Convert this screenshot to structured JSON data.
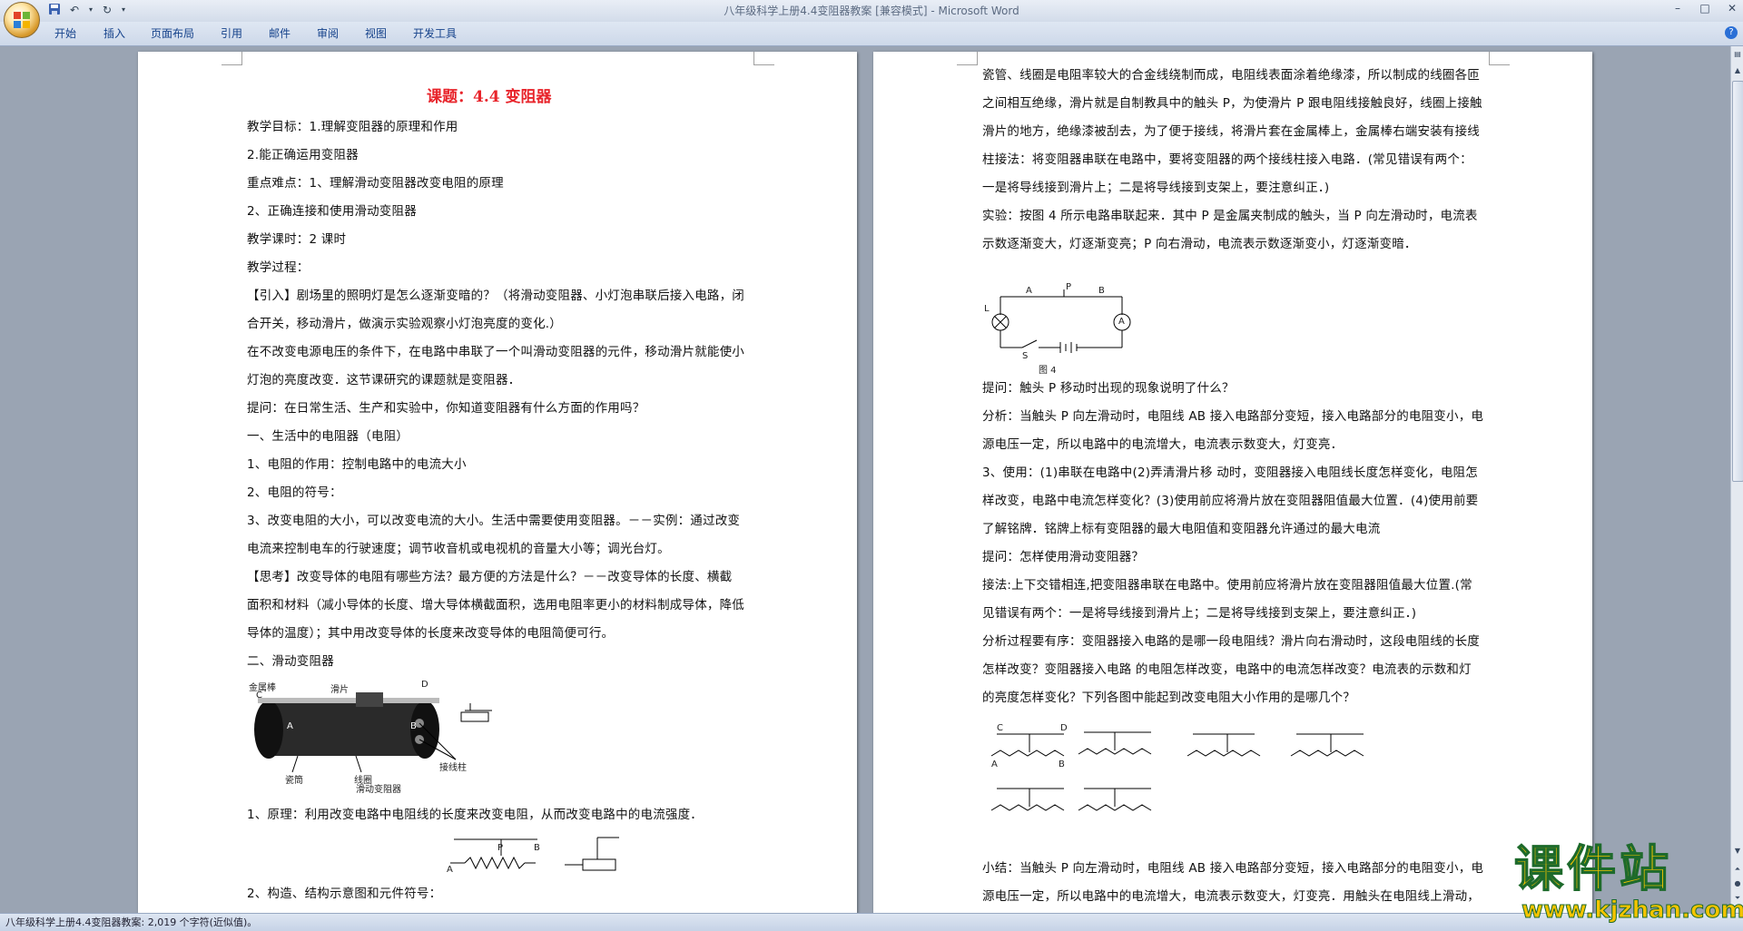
{
  "window": {
    "title": "八年级科学上册4.4变阻器教案 [兼容模式] - Microsoft Word"
  },
  "ribbon_tabs": [
    "开始",
    "插入",
    "页面布局",
    "引用",
    "邮件",
    "审阅",
    "视图",
    "开发工具"
  ],
  "status_bar": {
    "text": "八年级科学上册4.4变阻器教案: 2,019 个字符(近似值)。"
  },
  "watermark": {
    "main": "课件站",
    "url": "www.kjzhan.com"
  },
  "left_page": {
    "title": "课题：4.4 变阻器",
    "lines": [
      "教学目标：1.理解变阻器的原理和作用",
      "2.能正确运用变阻器",
      "重点难点：1、理解滑动变阻器改变电阻的原理",
      "2、正确连接和使用滑动变阻器",
      "教学课时：2 课时",
      "教学过程：",
      "【引入】剧场里的照明灯是怎么逐渐变暗的？（将滑动变阻器、小灯泡串联后接入电路，闭",
      "合开关，移动滑片，做演示实验观察小灯泡亮度的变化.）",
      "在不改变电源电压的条件下，在电路中串联了一个叫滑动变阻器的元件，移动滑片就能使小",
      "灯泡的亮度改变．这节课研究的课题就是变阻器．",
      "提问：在日常生活、生产和实验中，你知道变阻器有什么方面的作用吗？",
      "一、生活中的电阻器（电阻）",
      "1、电阻的作用：控制电路中的电流大小",
      "2、电阻的符号：",
      "3、改变电阻的大小，可以改变电流的大小。生活中需要使用变阻器。－－实例：通过改变",
      "电流来控制电车的行驶速度；调节收音机或电视机的音量大小等；调光台灯。",
      "【思考】改变导体的电阻有哪些方法？最方便的方法是什么？－－改变导体的长度、横截",
      "面积和材料（减小导体的长度、增大导体横截面积，选用电阻率更小的材料制成导体，降低",
      "导体的温度）；其中用改变导体的长度来改变导体的电阻简便可行。",
      "二、滑动变阻器"
    ],
    "figure_labels": [
      "金属棒",
      "滑片",
      "C",
      "D",
      "A",
      "B",
      "瓷筒",
      "线圈",
      "接线柱",
      "滑动变阻器"
    ],
    "lines2": [
      "1、原理：利用改变电路中电阻线的长度来改变电阻，从而改变电路中的电流强度．",
      "2、构造、结构示意图和元件符号："
    ],
    "schematic_labels": [
      "A",
      "P",
      "B"
    ]
  },
  "right_page": {
    "lines": [
      "瓷管、线圈是电阻率较大的合金线绕制而成，电阻线表面涂着绝缘漆，所以制成的线圈各匝",
      "之间相互绝缘，滑片就是自制教具中的触头 P，为使滑片 P 跟电阻线接触良好，线圈上接触",
      "滑片的地方，绝缘漆被刮去，为了便于接线，将滑片套在金属棒上，金属棒右端安装有接线",
      "柱接法：将变阻器串联在电路中，要将变阻器的两个接线柱接入电路．(常见错误有两个：",
      "一是将导线接到滑片上；二是将导线接到支架上，要注意纠正．)",
      "实验：按图 4 所示电路串联起来．其中 P 是金属夹制成的触头，当 P 向左滑动时，电流表",
      "示数逐渐变大，灯逐渐变亮；P 向右滑动，电流表示数逐渐变小，灯逐渐变暗．"
    ],
    "circuit_labels": [
      "L",
      "A",
      "P",
      "B",
      "A",
      "S",
      "图 4"
    ],
    "lines2": [
      "提问：触头 P 移动时出现的现象说明了什么？",
      "分析：当触头 P 向左滑动时，电阻线 AB 接入电路部分变短，接入电路部分的电阻变小，电",
      "源电压一定，所以电路中的电流增大，电流表示数变大，灯变亮．",
      "3、使用：(1)串联在电路中(2)弄清滑片移 动时，变阻器接入电阻线长度怎样变化，电阻怎",
      "样改变，电路中电流怎样变化？(3)使用前应将滑片放在变阻器阻值最大位置．(4)使用前要",
      "了解铭牌．铭牌上标有变阻器的最大电阻值和变阻器允许通过的最大电流",
      "提问：怎样使用滑动变阻器？",
      "接法:上下交错相连,把变阻器串联在电路中。使用前应将滑片放在变阻器阻值最大位置.(常",
      "见错误有两个：一是将导线接到滑片上；二是将导线接到支架上，要注意纠正．)",
      "分析过程要有序：变阻器接入电路的是哪一段电阻线？滑片向右滑动时，这段电阻线的长度",
      "怎样改变？变阻器接入电路 的电阻怎样改变，电路中的电流怎样改变？电流表的示数和灯",
      "的亮度怎样变化？下列各图中能起到改变电阻大小作用的是哪几个？"
    ],
    "rheostat_labels": [
      "C",
      "D",
      "A",
      "B"
    ],
    "lines3": [
      "小结：当触头 P 向左滑动时，电阻线 AB 接入电路部分变短，接入电路部分的电阻变小，电",
      "源电压一定，所以电路中的电流增大，电流表示数变大，灯变亮．用触头在电阻线上滑动，"
    ]
  }
}
